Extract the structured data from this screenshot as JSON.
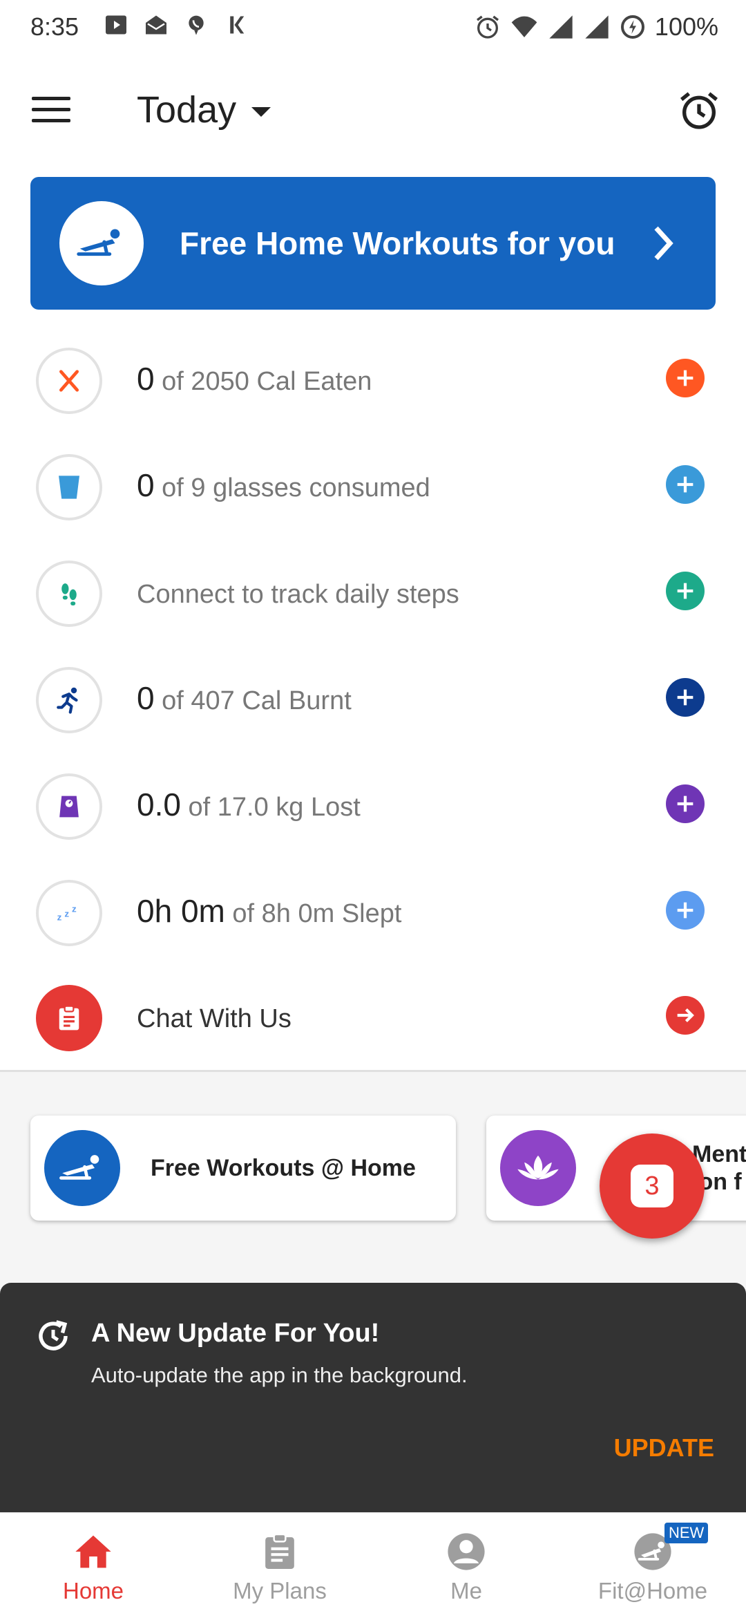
{
  "status_bar": {
    "time": "8:35",
    "battery": "100%"
  },
  "app_bar": {
    "title": "Today"
  },
  "banner": {
    "label": "Free Home Workouts for you"
  },
  "trackers": [
    {
      "value": "0",
      "text": " of 2050 Cal Eaten",
      "icon": "fork-knife-icon",
      "color": "#FF5722"
    },
    {
      "value": "0",
      "text": " of 9 glasses consumed",
      "icon": "water-glass-icon",
      "color": "#3A9AD9"
    },
    {
      "value": "",
      "text": "Connect to track daily steps",
      "icon": "footsteps-icon",
      "color": "#1DAA8A"
    },
    {
      "value": "0",
      "text": " of 407 Cal Burnt",
      "icon": "runner-icon",
      "color": "#0D3B8E"
    },
    {
      "value": "0.0",
      "text": " of 17.0 kg Lost",
      "icon": "weight-scale-icon",
      "color": "#6F35B5"
    },
    {
      "value": "0h 0m",
      "text": " of 8h 0m Slept",
      "icon": "sleep-zzz-icon",
      "color": "#5C9CF0"
    },
    {
      "value": "",
      "text": "Chat With Us",
      "icon": "clipboard-icon",
      "color": "#E53935"
    }
  ],
  "cards": [
    {
      "label": "Free Workouts @ Home",
      "icon": "pushup-icon",
      "color": "#1565C0"
    },
    {
      "label": "Menta",
      "label2": "ion f",
      "icon": "lotus-icon",
      "color": "#8E44C7"
    }
  ],
  "fab": {
    "count": "3"
  },
  "snackbar": {
    "title": "A New Update For You!",
    "subtitle": "Auto-update the app in the background.",
    "action": "UPDATE"
  },
  "bottom_nav": {
    "tabs": [
      {
        "label": "Home",
        "icon": "home-icon",
        "active": true
      },
      {
        "label": "My Plans",
        "icon": "clipboard-plan-icon",
        "active": false
      },
      {
        "label": "Me",
        "icon": "profile-icon",
        "active": false
      },
      {
        "label": "Fit@Home",
        "icon": "pushup-icon",
        "active": false,
        "badge": "NEW"
      }
    ]
  },
  "colors": {
    "primary": "#1565C0",
    "accent_red": "#E53935",
    "update_orange": "#F57C00"
  }
}
